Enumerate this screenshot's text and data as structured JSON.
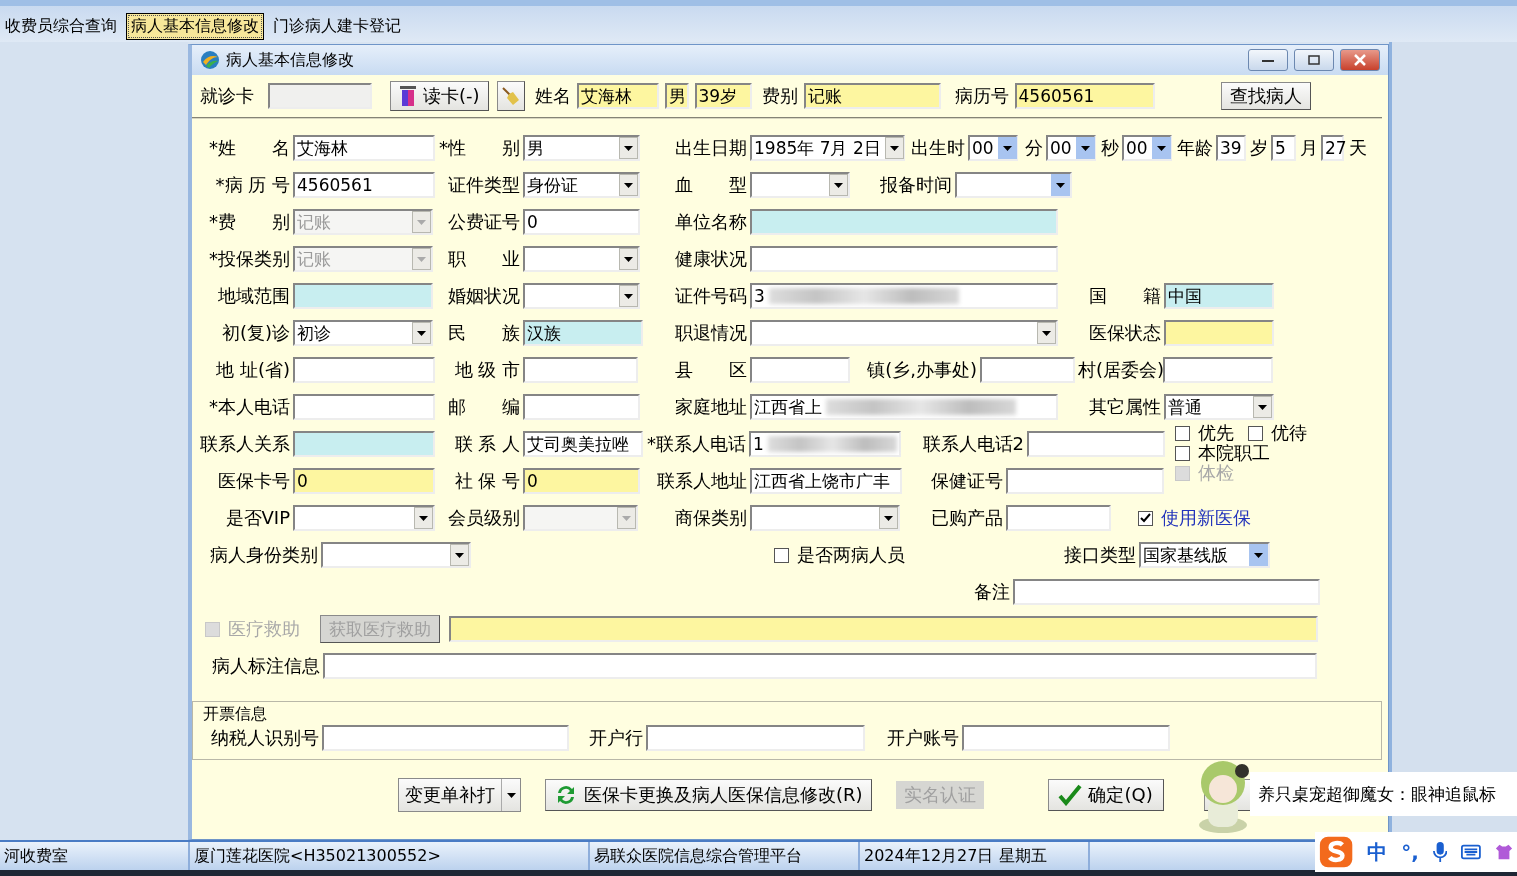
{
  "tabs": [
    {
      "label": "收费员综合查询",
      "selected": false
    },
    {
      "label": "病人基本信息修改",
      "selected": true
    },
    {
      "label": "门诊病人建卡登记",
      "selected": false
    }
  ],
  "dialog": {
    "title": "病人基本信息修改",
    "header": {
      "card_label": "就诊卡",
      "read_button": "读卡(-)",
      "name_label": "姓名",
      "name": "艾海林",
      "sex": "男",
      "age": "39岁",
      "fee_label": "费别",
      "fee": "记账",
      "record_label": "病历号",
      "record": "4560561",
      "find_button": "查找病人"
    },
    "rows": [
      {
        "items": [
          {
            "kind": "label",
            "text": "*姓　　名"
          },
          {
            "kind": "field",
            "value": "艾海林",
            "color": "#ffffff"
          },
          {
            "kind": "label",
            "text": "*性　　别"
          },
          {
            "kind": "combo",
            "value": "男",
            "disabled": false
          },
          {
            "kind": "label",
            "text": "出生日期"
          },
          {
            "kind": "combo",
            "value": "1985年 7月 2日",
            "disabled": false
          },
          {
            "kind": "label",
            "text": "出生时"
          },
          {
            "kind": "spin",
            "value": "00"
          },
          {
            "kind": "label",
            "text": "分"
          },
          {
            "kind": "spin",
            "value": "00"
          },
          {
            "kind": "label",
            "text": "秒"
          },
          {
            "kind": "spin",
            "value": "00"
          },
          {
            "kind": "label",
            "text": "年龄"
          },
          {
            "kind": "field",
            "value": "39",
            "color": "#ffffff"
          },
          {
            "kind": "label",
            "text": "岁"
          },
          {
            "kind": "field",
            "value": "5",
            "color": "#ffffff"
          },
          {
            "kind": "label",
            "text": "月"
          },
          {
            "kind": "field",
            "value": "27",
            "color": "#ffffff"
          },
          {
            "kind": "label",
            "text": "天"
          }
        ]
      },
      {
        "items": [
          {
            "kind": "label",
            "text": "*病 历 号"
          },
          {
            "kind": "field",
            "value": "4560561",
            "color": "#ffffff"
          },
          {
            "kind": "label",
            "text": "证件类型"
          },
          {
            "kind": "combo",
            "value": "身份证",
            "disabled": false
          },
          {
            "kind": "label",
            "text": "血　　型"
          },
          {
            "kind": "combo",
            "disabled": false
          },
          {
            "kind": "label",
            "text": "报备时间"
          },
          {
            "kind": "spin"
          }
        ]
      },
      {
        "items": [
          {
            "kind": "label",
            "text": "*费　　别"
          },
          {
            "kind": "combo",
            "value": "记账",
            "disabled": true
          },
          {
            "kind": "label",
            "text": "公费证号"
          },
          {
            "kind": "field",
            "value": "0",
            "color": "#ffffff"
          },
          {
            "kind": "label",
            "text": "单位名称"
          },
          {
            "kind": "field",
            "color": "#c8eef0"
          }
        ]
      },
      {
        "items": [
          {
            "kind": "label",
            "text": "*投保类别"
          },
          {
            "kind": "combo",
            "value": "记账",
            "disabled": true
          },
          {
            "kind": "label",
            "text": "职　　业"
          },
          {
            "kind": "combo",
            "disabled": false
          },
          {
            "kind": "label",
            "text": "健康状况"
          },
          {
            "kind": "field",
            "color": "#ffffff"
          }
        ]
      },
      {
        "items": [
          {
            "kind": "label",
            "text": "地域范围"
          },
          {
            "kind": "field",
            "color": "#c8eef0"
          },
          {
            "kind": "label",
            "text": "婚姻状况"
          },
          {
            "kind": "combo",
            "disabled": false
          },
          {
            "kind": "label",
            "text": "证件号码"
          },
          {
            "kind": "field",
            "value": "3",
            "color": "#ffffff",
            "blurred": true
          },
          {
            "kind": "label",
            "text": "国　　籍"
          },
          {
            "kind": "field",
            "value": "中国",
            "color": "#c8eef0"
          }
        ]
      },
      {
        "items": [
          {
            "kind": "label",
            "text": "初(复)诊"
          },
          {
            "kind": "combo",
            "value": "初诊",
            "disabled": false
          },
          {
            "kind": "label",
            "text": "民　　族"
          },
          {
            "kind": "field",
            "value": "汉族",
            "color": "#c8eef0"
          },
          {
            "kind": "label",
            "text": "职退情况"
          },
          {
            "kind": "combo",
            "disabled": false
          },
          {
            "kind": "label",
            "text": "医保状态"
          },
          {
            "kind": "field",
            "color": "#fdf6a0"
          }
        ]
      },
      {
        "items": [
          {
            "kind": "label",
            "text": "地 址(省)"
          },
          {
            "kind": "field",
            "color": "#ffffff"
          },
          {
            "kind": "label",
            "text": "地 级 市"
          },
          {
            "kind": "field",
            "color": "#ffffff"
          },
          {
            "kind": "label",
            "text": "县　　区"
          },
          {
            "kind": "field",
            "color": "#ffffff"
          },
          {
            "kind": "label",
            "text": "镇(乡,办事处)"
          },
          {
            "kind": "field",
            "color": "#ffffff"
          },
          {
            "kind": "label",
            "text": "村(居委会)"
          },
          {
            "kind": "field",
            "color": "#ffffff"
          }
        ]
      },
      {
        "items": [
          {
            "kind": "label",
            "text": "*本人电话"
          },
          {
            "kind": "field",
            "color": "#ffffff"
          },
          {
            "kind": "label",
            "text": "邮　　编"
          },
          {
            "kind": "field",
            "color": "#ffffff"
          },
          {
            "kind": "label",
            "text": "家庭地址"
          },
          {
            "kind": "field",
            "value": "江西省上",
            "color": "#ffffff",
            "blurred": true
          },
          {
            "kind": "label",
            "text": "其它属性"
          },
          {
            "kind": "combo",
            "value": "普通",
            "disabled": false
          }
        ]
      },
      {
        "items": [
          {
            "kind": "label",
            "text": "联系人关系"
          },
          {
            "kind": "field",
            "color": "#c8eef0"
          },
          {
            "kind": "label",
            "text": "联 系 人"
          },
          {
            "kind": "field",
            "value": "艾司奥美拉唑",
            "color": "#ffffff"
          },
          {
            "kind": "label",
            "text": "*联系人电话"
          },
          {
            "kind": "field",
            "value": "1",
            "color": "#ffffff",
            "blurred": true
          },
          {
            "kind": "label",
            "text": "联系人电话2"
          },
          {
            "kind": "field",
            "color": "#ffffff"
          }
        ]
      },
      {
        "items": [
          {
            "kind": "label",
            "text": "医保卡号"
          },
          {
            "kind": "field",
            "value": "0",
            "color": "#fdf6a0"
          },
          {
            "kind": "label",
            "text": "社 保 号"
          },
          {
            "kind": "field",
            "value": "0",
            "color": "#fdf6a0"
          },
          {
            "kind": "label",
            "text": "联系人地址"
          },
          {
            "kind": "field",
            "value": "江西省上饶市广丰",
            "color": "#ffffff"
          },
          {
            "kind": "label",
            "text": "保健证号"
          },
          {
            "kind": "field",
            "color": "#ffffff"
          }
        ]
      },
      {
        "items": [
          {
            "kind": "label",
            "text": "是否VIP"
          },
          {
            "kind": "combo",
            "disabled": false
          },
          {
            "kind": "label",
            "text": "会员级别"
          },
          {
            "kind": "combo",
            "disabled": true
          },
          {
            "kind": "label",
            "text": "商保类别"
          },
          {
            "kind": "combo",
            "disabled": false
          },
          {
            "kind": "label",
            "text": "已购产品"
          },
          {
            "kind": "field",
            "color": "#ffffff"
          },
          {
            "kind": "check",
            "label": "使用新医保",
            "checked": true,
            "disabled": false
          }
        ]
      },
      {
        "items": [
          {
            "kind": "label",
            "text": "病人身份类别"
          },
          {
            "kind": "combo",
            "disabled": false
          },
          {
            "kind": "check",
            "label": "是否两病人员",
            "checked": false,
            "disabled": false
          },
          {
            "kind": "label",
            "text": "接口类型"
          },
          {
            "kind": "spin",
            "value": "国家基线版"
          }
        ]
      },
      {
        "items": [
          {
            "kind": "label",
            "text": "备注"
          },
          {
            "kind": "field",
            "color": "#ffffff"
          }
        ]
      },
      {
        "items": [
          {
            "kind": "check",
            "label": "医疗救助",
            "checked": false,
            "disabled": true
          },
          {
            "kind": "button",
            "label": "获取医疗救助",
            "disabled": true
          },
          {
            "kind": "field",
            "color": "#fdf6a0"
          }
        ]
      },
      {
        "items": [
          {
            "kind": "label",
            "text": "病人标注信息"
          },
          {
            "kind": "field",
            "color": "#ffffff"
          }
        ]
      }
    ],
    "side_checks": [
      {
        "label": "优先",
        "checked": false,
        "disabled": false
      },
      {
        "label": "优待",
        "checked": false,
        "disabled": false
      },
      {
        "label": "本院职工",
        "checked": false,
        "disabled": false
      },
      {
        "label": "体检",
        "checked": false,
        "disabled": true
      }
    ],
    "invoice": {
      "title": "开票信息",
      "items": [
        {
          "kind": "label",
          "text": "纳税人识别号"
        },
        {
          "kind": "field",
          "color": "#ffffff"
        },
        {
          "kind": "label",
          "text": "开户行"
        },
        {
          "kind": "field",
          "color": "#ffffff"
        },
        {
          "kind": "label",
          "text": "开户账号"
        },
        {
          "kind": "field",
          "color": "#ffffff"
        }
      ]
    },
    "buttons": {
      "reprint": "变更单补打",
      "insurance": "医保卡更换及病人医保信息修改(R)",
      "realname": {
        "label": "实名认证",
        "disabled": true
      },
      "ok": "确定(Q)"
    }
  },
  "status_bar": [
    "河收费室",
    "厦门莲花医院<H35021300552>",
    "易联众医院信息综合管理平台",
    "2024年12月27日 星期五"
  ],
  "pet_bubble": "养只桌宠超御魔女：眼神追鼠标",
  "ime": {
    "mode": "中",
    "punct": "°,"
  }
}
